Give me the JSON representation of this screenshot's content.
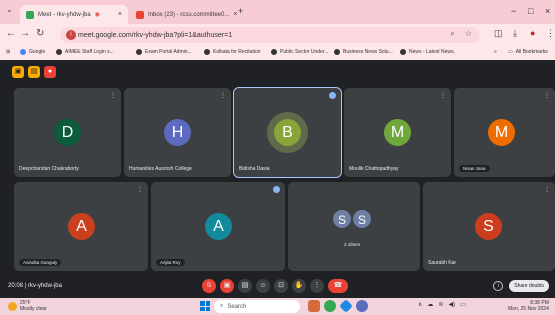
{
  "browser": {
    "tabs": [
      {
        "label": "Meet - rkv-yhdw-jba",
        "close": "×"
      },
      {
        "label": "Inbox (23) - rcsu.committee0...",
        "close": "×"
      }
    ],
    "new_tab": "+",
    "window_controls": {
      "minimize": "−",
      "maximize": "□",
      "close": "×"
    },
    "url": "meet.google.com/rkv-yhdw-jba?pli=1&authuser=1",
    "bookmarks": [
      "Google",
      "AIMEE Staff Login s...",
      "Exam Portal Admin...",
      "Kolkata for Recitation",
      "Public Sector Under...",
      "Business News Solu...",
      "News - Latest News,"
    ],
    "all_bookmarks": "All Bookmarks"
  },
  "meet": {
    "participants": [
      {
        "initial": "D",
        "name": "Deepchandan Chakraborty",
        "color": "#0b5c3a"
      },
      {
        "initial": "H",
        "name": "Humanities Ausrosh College",
        "color": "#5c6bc0"
      },
      {
        "initial": "B",
        "name": "Bidisha Dasia",
        "color": "#8aa43a"
      },
      {
        "initial": "M",
        "name": "Moulik Chattopadhyay",
        "color": "#6fa83a"
      },
      {
        "initial": "M",
        "name": "Nisan Jana",
        "color": "#ef6c00"
      },
      {
        "initial": "A",
        "name": "Anindita Ganguly",
        "color": "#c9401e"
      },
      {
        "initial": "A",
        "name": "Arijita Roy",
        "color": "#128a9e"
      },
      {
        "initial": "S",
        "initial2": "S",
        "name": "2 others",
        "color": "#6d7fa3"
      },
      {
        "initial": "S",
        "name": "Saurabh Kar",
        "color": "#cc3d1d"
      }
    ],
    "footer_time": "20:08",
    "meeting_code": "rkv-yhdw-jba",
    "share_label": "Share doubts"
  },
  "taskbar": {
    "temp": "25°F",
    "weather": "Mostly clear",
    "search_placeholder": "Search",
    "time": "8:38 PM",
    "date": "Mon, 25 Nov 2024"
  }
}
